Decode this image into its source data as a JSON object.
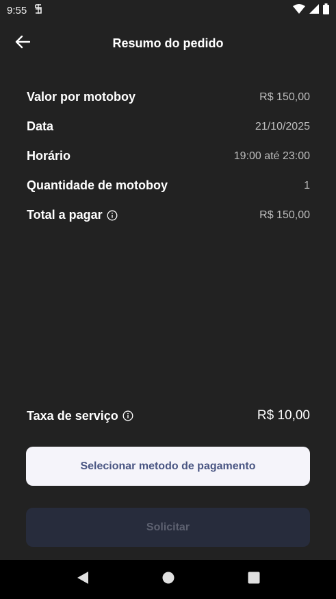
{
  "status_bar": {
    "time": "9:55",
    "icons": [
      "notification-icon",
      "wifi-icon",
      "signal-icon",
      "battery-icon"
    ]
  },
  "header": {
    "title": "Resumo do pedido",
    "back_icon": "arrow-left-icon"
  },
  "summary": {
    "rows": [
      {
        "label": "Valor por motoboy",
        "value": "R$ 150,00"
      },
      {
        "label": "Data",
        "value": "21/10/2025"
      },
      {
        "label": "Horário",
        "value": "19:00 até 23:00"
      },
      {
        "label": "Quantidade de motoboy",
        "value": "1"
      },
      {
        "label": "Total a pagar",
        "value": "R$ 150,00",
        "info_icon": true
      }
    ]
  },
  "fee": {
    "label": "Taxa de serviço",
    "value": "R$ 10,00",
    "info_icon": true
  },
  "buttons": {
    "payment_label": "Selecionar metodo de pagamento",
    "request_label": "Solicitar"
  },
  "nav": {
    "icons": [
      "back-triangle-icon",
      "home-circle-icon",
      "recents-square-icon"
    ]
  },
  "colors": {
    "background": "#222222",
    "payment_button_bg": "#f5f4fa",
    "payment_button_text": "#4a5683",
    "request_button_bg": "#272c3c",
    "request_button_text": "#5d6170"
  }
}
